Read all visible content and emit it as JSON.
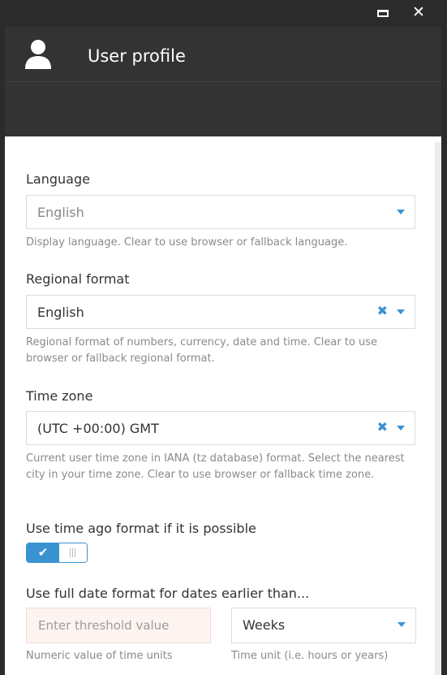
{
  "header": {
    "title": "User profile"
  },
  "window_controls": {
    "close_glyph": "✕"
  },
  "fields": {
    "language": {
      "label": "Language",
      "value": "English",
      "help": "Display language. Clear to use browser or fallback language."
    },
    "regional_format": {
      "label": "Regional format",
      "value": "English",
      "help": "Regional format of numbers, currency, date and time. Clear to use browser or fallback regional format."
    },
    "time_zone": {
      "label": "Time zone",
      "value": "(UTC +00:00) GMT",
      "help": "Current user time zone in IANA (tz database) format. Select the nearest city in your time zone. Clear to use browser or fallback time zone."
    },
    "time_ago": {
      "label": "Use time ago format if it is possible",
      "enabled": true,
      "check_glyph": "✔"
    },
    "full_date": {
      "label": "Use full date format for dates earlier than...",
      "threshold_placeholder": "Enter threshold value",
      "threshold_help": "Numeric value of time units",
      "unit_value": "Weeks",
      "unit_help": "Time unit (i.e. hours or years)"
    }
  },
  "colors": {
    "accent": "#3a93d1",
    "header_bg": "#333333",
    "titlebar_bg": "#2b2b2b",
    "invalid_bg": "#fdf3f0"
  }
}
